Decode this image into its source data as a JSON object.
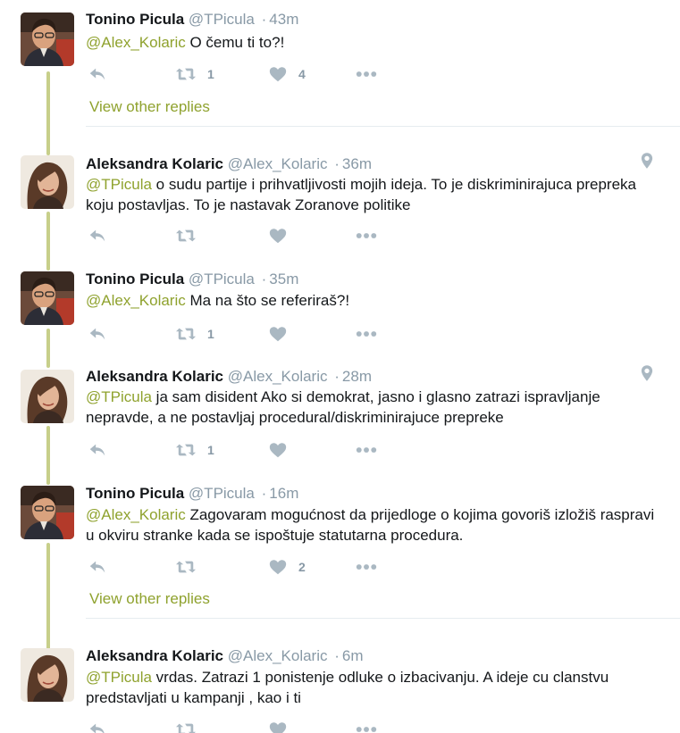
{
  "accent_color": "#8fa22e",
  "thread_line_color": "#c7cf8a",
  "icons": {
    "reply": "reply-icon",
    "retweet": "retweet-icon",
    "like": "heart-icon",
    "more": "more-dots-icon",
    "location": "location-pin-icon"
  },
  "view_other_replies": "View other replies",
  "tweets": [
    {
      "name": "Tonino Picula",
      "handle": "@TPicula",
      "sep": "·",
      "time": "43m",
      "mention": "@Alex_Kolaric",
      "text": " O čemu ti to?!",
      "retweets": "1",
      "likes": "4"
    },
    {
      "name": "Aleksandra Kolaric",
      "handle": "@Alex_Kolaric",
      "sep": "·",
      "time": "36m",
      "mention": "@TPicula",
      "text": " o sudu partije i prihvatljivosti mojih ideja. To je diskriminirajuca prepreka koju postavljas. To je nastavak Zoranove politike",
      "retweets": "",
      "likes": ""
    },
    {
      "name": "Tonino Picula",
      "handle": "@TPicula",
      "sep": "·",
      "time": "35m",
      "mention": "@Alex_Kolaric",
      "text": " Ma na što se referiraš?!",
      "retweets": "1",
      "likes": ""
    },
    {
      "name": "Aleksandra Kolaric",
      "handle": "@Alex_Kolaric",
      "sep": "·",
      "time": "28m",
      "mention": "@TPicula",
      "text": " ja sam disident Ako si demokrat, jasno i glasno zatrazi ispravljanje nepravde, a ne postavljaj procedural/diskriminirajuce prepreke",
      "retweets": "1",
      "likes": ""
    },
    {
      "name": "Tonino Picula",
      "handle": "@TPicula",
      "sep": "·",
      "time": "16m",
      "mention": "@Alex_Kolaric",
      "text": " Zagovaram mogućnost da prijedloge o kojima govoriš izložiš raspravi u okviru stranke kada se ispoštuje statutarna procedura.",
      "retweets": "",
      "likes": "2"
    },
    {
      "name": "Aleksandra Kolaric",
      "handle": "@Alex_Kolaric",
      "sep": "·",
      "time": "6m",
      "mention": "@TPicula",
      "text": " vrdas. Zatrazi 1 ponistenje odluke o izbacivanju. A ideje cu clanstvu predstavljati u kampanji , kao i ti",
      "retweets": "",
      "likes": ""
    }
  ]
}
